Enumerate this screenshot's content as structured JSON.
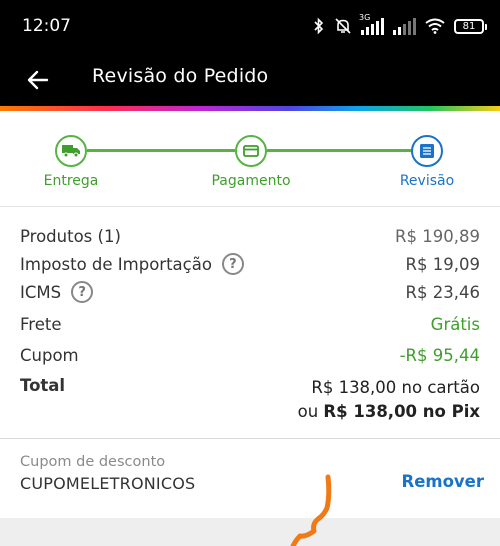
{
  "status_bar": {
    "time": "12:07",
    "network_label": "3G",
    "battery": "81"
  },
  "app_bar": {
    "title": "Revisão do Pedido",
    "back_icon": "arrow-left-icon"
  },
  "stepper": {
    "steps": [
      {
        "label": "Entrega",
        "icon": "truck-icon",
        "state": "done"
      },
      {
        "label": "Pagamento",
        "icon": "credit-card-icon",
        "state": "done"
      },
      {
        "label": "Revisão",
        "icon": "list-icon",
        "state": "active"
      }
    ]
  },
  "summary": {
    "products": {
      "label": "Produtos (1)",
      "value": "R$ 190,89"
    },
    "import_tax": {
      "label": "Imposto de Importação",
      "value": "R$ 19,09"
    },
    "icms": {
      "label": "ICMS",
      "value": "R$ 23,46"
    },
    "shipping": {
      "label": "Frete",
      "value": "Grátis"
    },
    "coupon": {
      "label": "Cupom",
      "value": "-R$ 95,44"
    },
    "total": {
      "label": "Total",
      "card_line": "R$ 138,00 no cartão",
      "pix_prefix": "ou",
      "pix_amount": "R$ 138,00 no Pix"
    }
  },
  "coupon": {
    "label": "Cupom de desconto",
    "code": "CUPOMELETRONICOS",
    "remove_label": "Remover"
  },
  "colors": {
    "accent_green": "#3f9e2c",
    "accent_blue": "#1a73c8",
    "scribble_orange": "#f07a16"
  }
}
